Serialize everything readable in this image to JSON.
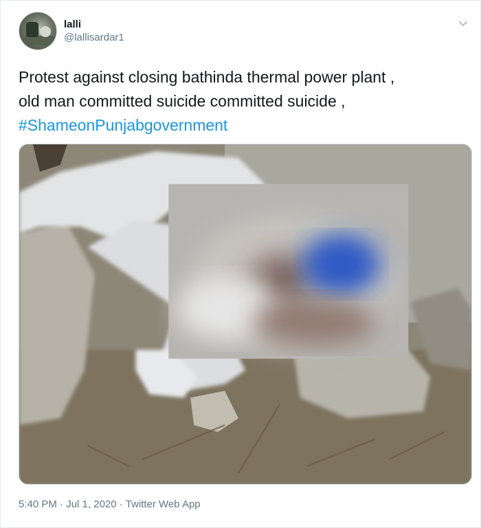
{
  "tweet": {
    "display_name": "lalli",
    "handle": "@lallisardar1",
    "text_line1": "Protest against closing bathinda thermal power plant ,",
    "text_line2": "old man committed suicide committed suicide ,",
    "hashtag": "#ShameonPunjabgovernment",
    "time": "5:40 PM",
    "date": "Jul 1, 2020",
    "source": "Twitter Web App",
    "separator": "·"
  },
  "icons": {
    "menu": "chevron-down-icon",
    "avatar": "avatar"
  },
  "colors": {
    "link": "#1b95e0",
    "secondary_text": "#657786",
    "primary_text": "#14171a"
  }
}
